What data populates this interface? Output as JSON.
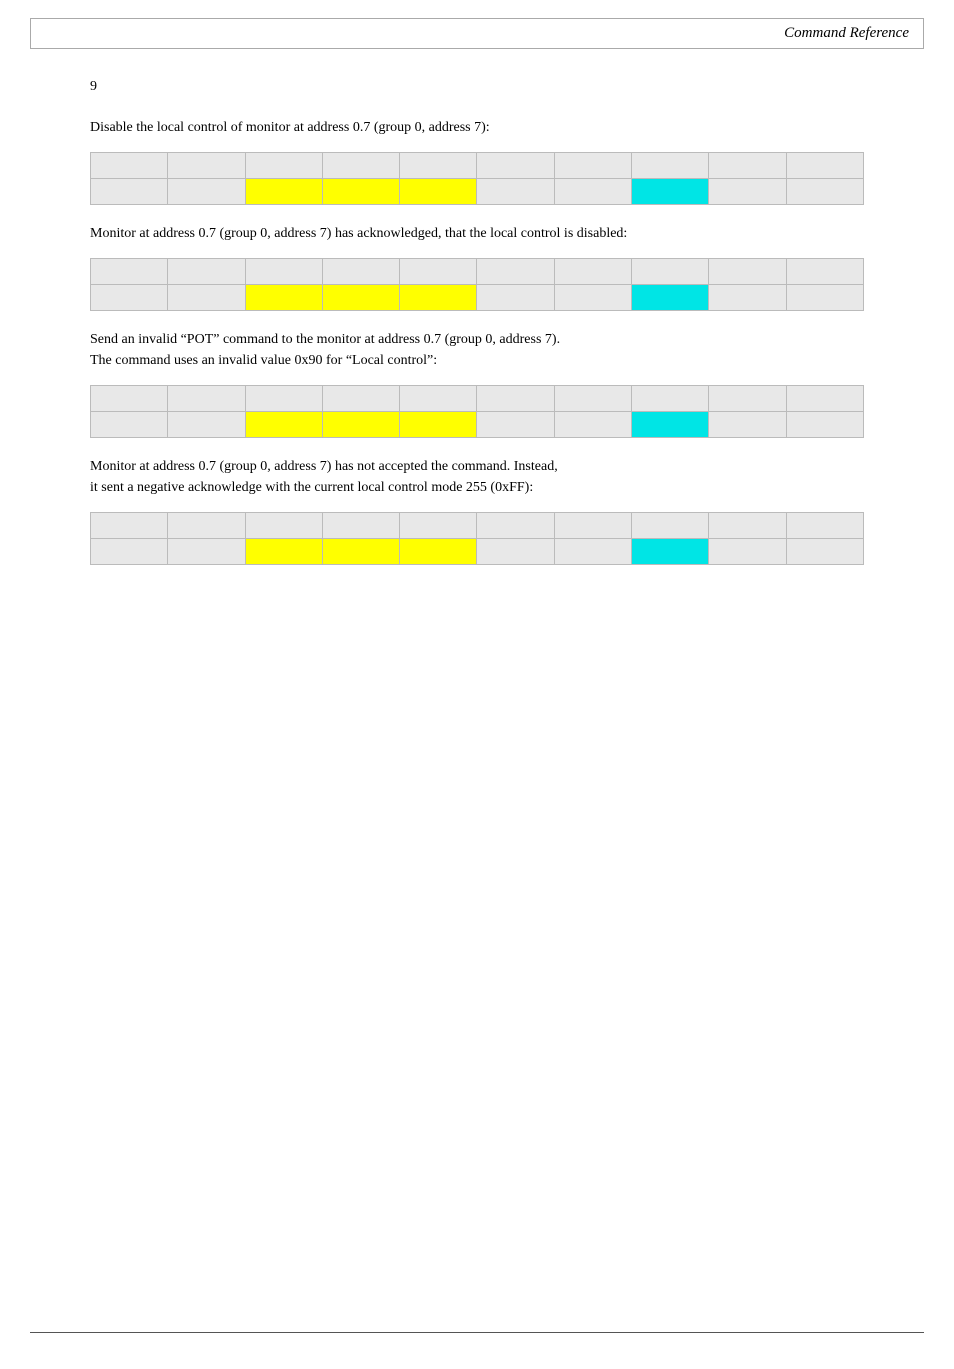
{
  "header": {
    "title": "Command Reference"
  },
  "page_number": "9",
  "sections": [
    {
      "id": "section1",
      "text": "Disable the local control of monitor at address 0.7 (group 0, address 7):",
      "table": {
        "row1": [
          "",
          "",
          "",
          "",
          "",
          "",
          "",
          "",
          "",
          ""
        ],
        "row2": [
          "grey",
          "grey",
          "yellow",
          "yellow",
          "yellow",
          "grey",
          "grey",
          "cyan",
          "grey",
          "grey"
        ]
      }
    },
    {
      "id": "section2",
      "text": "Monitor at address 0.7 (group 0, address 7) has acknowledged, that the local control is disabled:",
      "table": {
        "row1": [
          "",
          "",
          "",
          "",
          "",
          "",
          "",
          "",
          "",
          ""
        ],
        "row2": [
          "grey",
          "grey",
          "yellow",
          "yellow",
          "yellow",
          "grey",
          "grey",
          "cyan",
          "grey",
          "grey"
        ]
      }
    },
    {
      "id": "section3",
      "text1": "Send an invalid “POT” command to the monitor at address 0.7 (group 0, address 7).",
      "text2": "The command uses an invalid value 0x90 for “Local control”:",
      "table": {
        "row1": [
          "",
          "",
          "",
          "",
          "",
          "",
          "",
          "",
          "",
          ""
        ],
        "row2": [
          "grey",
          "grey",
          "yellow",
          "yellow",
          "yellow",
          "grey",
          "grey",
          "cyan",
          "grey",
          "grey"
        ]
      }
    },
    {
      "id": "section4",
      "text1": "Monitor at address 0.7 (group 0, address 7) has not accepted the command. Instead,",
      "text2": "it sent a negative acknowledge with the current local control mode 255 (0xFF):",
      "table": {
        "row1": [
          "",
          "",
          "",
          "",
          "",
          "",
          "",
          "",
          "",
          ""
        ],
        "row2": [
          "grey",
          "grey",
          "yellow",
          "yellow",
          "yellow",
          "grey",
          "grey",
          "cyan",
          "grey",
          "grey"
        ]
      }
    }
  ]
}
